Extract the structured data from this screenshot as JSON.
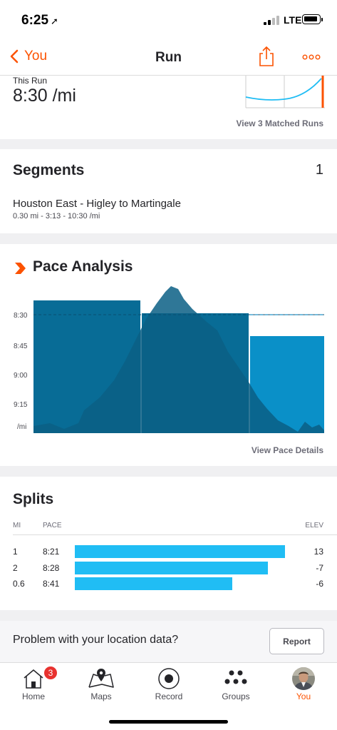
{
  "status_bar": {
    "time": "6:25",
    "network": "LTE"
  },
  "nav": {
    "back_label": "You",
    "title": "Run"
  },
  "run_summary": {
    "label": "This Run",
    "value": "8:30 /mi",
    "matched_runs_link": "View 3 Matched Runs"
  },
  "segments": {
    "heading": "Segments",
    "count": "1",
    "items": [
      {
        "name": "Houston East - Higley to Martingale",
        "stats": "0.30 mi - 3:13 - 10:30 /mi"
      }
    ]
  },
  "pace_analysis": {
    "heading": "Pace Analysis",
    "view_details_link": "View Pace Details",
    "colors": {
      "bar_dark": "#086c96",
      "bar_light": "#0a90c8",
      "elevation": "#0b5f85",
      "target_line": "#2293c9"
    }
  },
  "chart_data": {
    "type": "bar",
    "title": "Pace Analysis",
    "y_tick_labels": [
      "8:30",
      "8:45",
      "9:00",
      "9:15",
      "/mi"
    ],
    "categories": [
      "1",
      "2",
      "0.6"
    ],
    "series": [
      {
        "values": [
          "8:21",
          "8:28",
          "8:41"
        ]
      }
    ],
    "reference_line": "8:30",
    "background_series": "elevation profile"
  },
  "splits": {
    "heading": "Splits",
    "columns": {
      "mi": "MI",
      "pace": "PACE",
      "elev": "ELEV"
    },
    "rows": [
      {
        "mi": "1",
        "pace": "8:21",
        "elev": "13",
        "bar_fraction": 0.89
      },
      {
        "mi": "2",
        "pace": "8:28",
        "elev": "-7",
        "bar_fraction": 0.78
      },
      {
        "mi": "0.6",
        "pace": "8:41",
        "elev": "-6",
        "bar_fraction": 0.63
      }
    ],
    "bar_color": "#20bdf4"
  },
  "location_prompt": {
    "text": "Problem with your location data?",
    "button_label": "Report"
  },
  "tabs": [
    {
      "label": "Home",
      "icon": "home-icon",
      "badge": "3"
    },
    {
      "label": "Maps",
      "icon": "map-icon"
    },
    {
      "label": "Record",
      "icon": "record-icon"
    },
    {
      "label": "Groups",
      "icon": "groups-icon"
    },
    {
      "label": "You",
      "icon": "avatar",
      "active": true
    }
  ],
  "accent_color": "#fc5200"
}
